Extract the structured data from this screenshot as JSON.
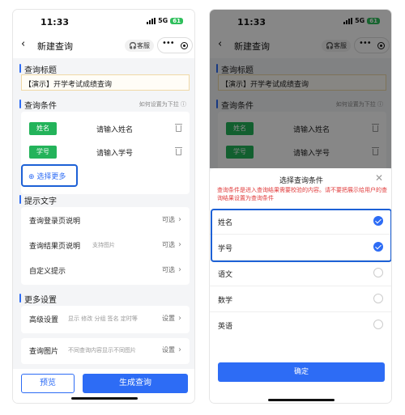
{
  "status": {
    "time": "11:33",
    "network": "5G",
    "battery": "61"
  },
  "nav": {
    "back": "‹",
    "title": "新建查询",
    "kefu": "🎧客服",
    "capsule_dots": "•••"
  },
  "left": {
    "section_title": "查询标题",
    "title_value": "【演示】开学考试成绩查询",
    "section_conditions": "查询条件",
    "dropdown_hint": "如何设置为下拉 ⓘ",
    "conditions": [
      {
        "tag": "姓名",
        "placeholder": "请输入姓名"
      },
      {
        "tag": "学号",
        "placeholder": "请输入学号"
      }
    ],
    "select_more": "⊕ 选择更多",
    "section_tips": "提示文字",
    "tips": [
      {
        "label": "查询登录页说明",
        "desc": "",
        "right": "可选"
      },
      {
        "label": "查询结果页说明",
        "desc": "支持图片",
        "right": "可选"
      },
      {
        "label": "自定义提示",
        "desc": "",
        "right": "可选"
      }
    ],
    "section_more": "更多设置",
    "more": [
      {
        "label": "高级设置",
        "desc": "显示 修改 分组 签名 定时等",
        "right": "设置"
      },
      {
        "label": "查询图片",
        "desc": "不同查询内容显示不同图片",
        "right": "设置"
      }
    ],
    "preview_btn": "预览",
    "generate_btn": "生成查询",
    "arrow": "›"
  },
  "sheet": {
    "title": "选择查询条件",
    "close": "✕",
    "hint": "查询条件是进入查询结果需要校验的内容。请不要把展示给用户的查询结果设置为查询条件",
    "options": [
      {
        "label": "姓名",
        "checked": true
      },
      {
        "label": "学号",
        "checked": true
      },
      {
        "label": "语文",
        "checked": false
      },
      {
        "label": "数学",
        "checked": false
      },
      {
        "label": "英语",
        "checked": false
      }
    ],
    "confirm": "确定"
  },
  "colors": {
    "accent": "#2d6cf5",
    "green_tag": "#23b35a",
    "highlight": "#1d61d6",
    "warning": "#e03a3a"
  }
}
